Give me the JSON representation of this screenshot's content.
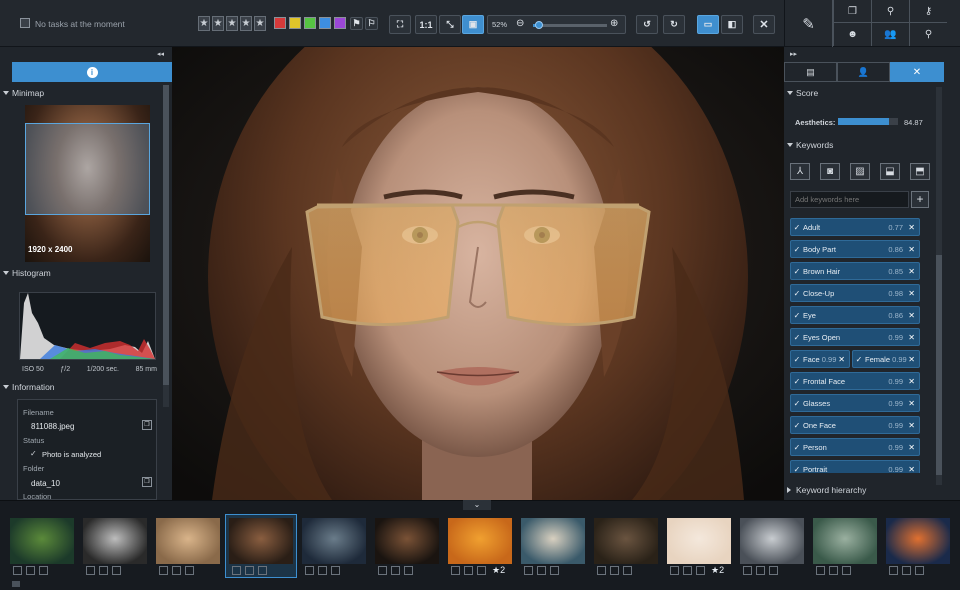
{
  "topbar": {
    "status": "No tasks at the moment",
    "stars": [
      "★",
      "★",
      "★",
      "★",
      "★"
    ],
    "color_labels": [
      "#d63a3a",
      "#e0c42a",
      "#56c242",
      "#3d8ee0",
      "#9b47d6"
    ],
    "one_to_one": "1:1",
    "zoom_label": "52%",
    "zoom_value": 0.05
  },
  "left": {
    "minimap_label": "Minimap",
    "dimensions": "1920 x 2400",
    "histogram_label": "Histogram",
    "iso": "ISO 50",
    "aperture": "ƒ/2",
    "shutter": "1/200 sec.",
    "focal": "85 mm",
    "information_label": "Information",
    "filename_label": "Filename",
    "filename": "811088.jpeg",
    "status_label": "Status",
    "status": "Photo is analyzed",
    "folder_label": "Folder",
    "folder": "data_10",
    "location_label": "Location"
  },
  "right": {
    "score_label": "Score",
    "aesthetics_label": "Aesthetics:",
    "aesthetics_value": "84.87",
    "aesthetics_fraction": 0.85,
    "keywords_label": "Keywords",
    "add_placeholder": "Add keywords here",
    "keywords": [
      {
        "label": "Adult",
        "score": "0.77"
      },
      {
        "label": "Body Part",
        "score": "0.86"
      },
      {
        "label": "Brown Hair",
        "score": "0.85"
      },
      {
        "label": "Close-Up",
        "score": "0.98"
      },
      {
        "label": "Eye",
        "score": "0.86"
      },
      {
        "label": "Eyes Open",
        "score": "0.99"
      }
    ],
    "face": {
      "label": "Face",
      "score": "0.99"
    },
    "female": {
      "label": "Female",
      "score": "0.99"
    },
    "keywords2": [
      {
        "label": "Frontal Face",
        "score": "0.99"
      },
      {
        "label": "Glasses",
        "score": "0.99"
      },
      {
        "label": "One Face",
        "score": "0.99"
      },
      {
        "label": "Person",
        "score": "0.99"
      },
      {
        "label": "Portrait",
        "score": "0.99"
      }
    ],
    "hierarchy_label": "Keyword hierarchy"
  },
  "film": {
    "thumbs": [
      {
        "c1": "#1c3a2a",
        "c2": "#5b8a3a",
        "star": ""
      },
      {
        "c1": "#2a2a2a",
        "c2": "#bdbdbd",
        "star": ""
      },
      {
        "c1": "#8a6a4a",
        "c2": "#d9b48a",
        "star": ""
      },
      {
        "c1": "#2a1e16",
        "c2": "#8a5e40",
        "star": ""
      },
      {
        "c1": "#1e2a3a",
        "c2": "#6a7c8a",
        "star": ""
      },
      {
        "c1": "#1a1410",
        "c2": "#7a5236",
        "star": ""
      },
      {
        "c1": "#c8681a",
        "c2": "#f0a030",
        "star": "★2"
      },
      {
        "c1": "#3a5a6a",
        "c2": "#d8d0c0",
        "star": ""
      },
      {
        "c1": "#2a2218",
        "c2": "#6a5440",
        "star": ""
      },
      {
        "c1": "#e8d4c0",
        "c2": "#f4e8dc",
        "star": "★2"
      },
      {
        "c1": "#4a5058",
        "c2": "#c8ccd0",
        "star": ""
      },
      {
        "c1": "#3a5a4a",
        "c2": "#9ab0a0",
        "star": ""
      },
      {
        "c1": "#1a2a4a",
        "c2": "#e07030",
        "star": ""
      }
    ]
  }
}
